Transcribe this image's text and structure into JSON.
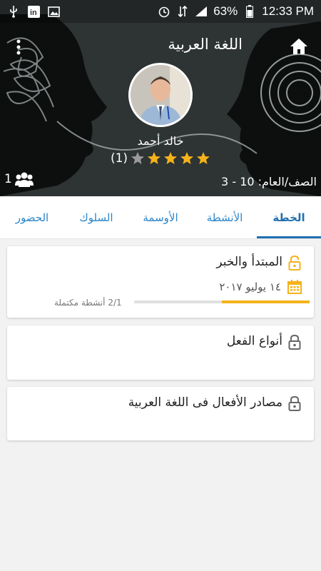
{
  "status_bar": {
    "battery": "63%",
    "time": "12:33 PM",
    "left_icons": [
      "usb-icon",
      "linkedin-icon",
      "image-icon"
    ],
    "right_icons": [
      "alarm-icon",
      "data-icon",
      "signal-icon",
      "battery-icon"
    ]
  },
  "header": {
    "title": "اللغة العربية",
    "teacher_name": "خالد أحمد",
    "rating_count": "(1)",
    "rating_value": 4,
    "rating_max": 5,
    "group_count": "1",
    "class_label": "الصف/العام: 10 - 3"
  },
  "tabs": [
    {
      "label": "الخطة",
      "active": true
    },
    {
      "label": "الأنشطة",
      "active": false
    },
    {
      "label": "الأوسمة",
      "active": false
    },
    {
      "label": "السلوك",
      "active": false
    },
    {
      "label": "الحضور",
      "active": false
    }
  ],
  "lessons": [
    {
      "title": "المبتدأ والخبر",
      "date": "١٤ يوليو ٢٠١٧",
      "progress_label": "2/1 أنشطة مكتملة",
      "progress_fraction": 0.5,
      "unlocked": true
    },
    {
      "title": "أنواع الفعل",
      "unlocked": false
    },
    {
      "title": "مصادر الأفعال فى اللغة العربية",
      "unlocked": false
    }
  ],
  "colors": {
    "accent": "#1f6fb0",
    "tab_text": "#2a85c9",
    "star": "#f5b21a",
    "progress": "#f5b21a",
    "lock_unlocked": "#f5b21a",
    "lock_locked": "#666666"
  }
}
